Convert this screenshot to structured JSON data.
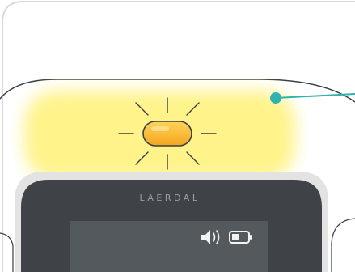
{
  "device": {
    "brand": "LAERDAL",
    "indicator": {
      "state": "lit",
      "color": "#f7b72e",
      "glow_color": "#fff176"
    },
    "status_icons": [
      "speaker-icon",
      "battery-icon"
    ],
    "battery_level": 0.5
  },
  "callout": {
    "line_color": "#2fb2b0"
  },
  "colors": {
    "casing_outline": "#3a3f45",
    "bezel": "#3f4347",
    "screen": "#54595d"
  }
}
